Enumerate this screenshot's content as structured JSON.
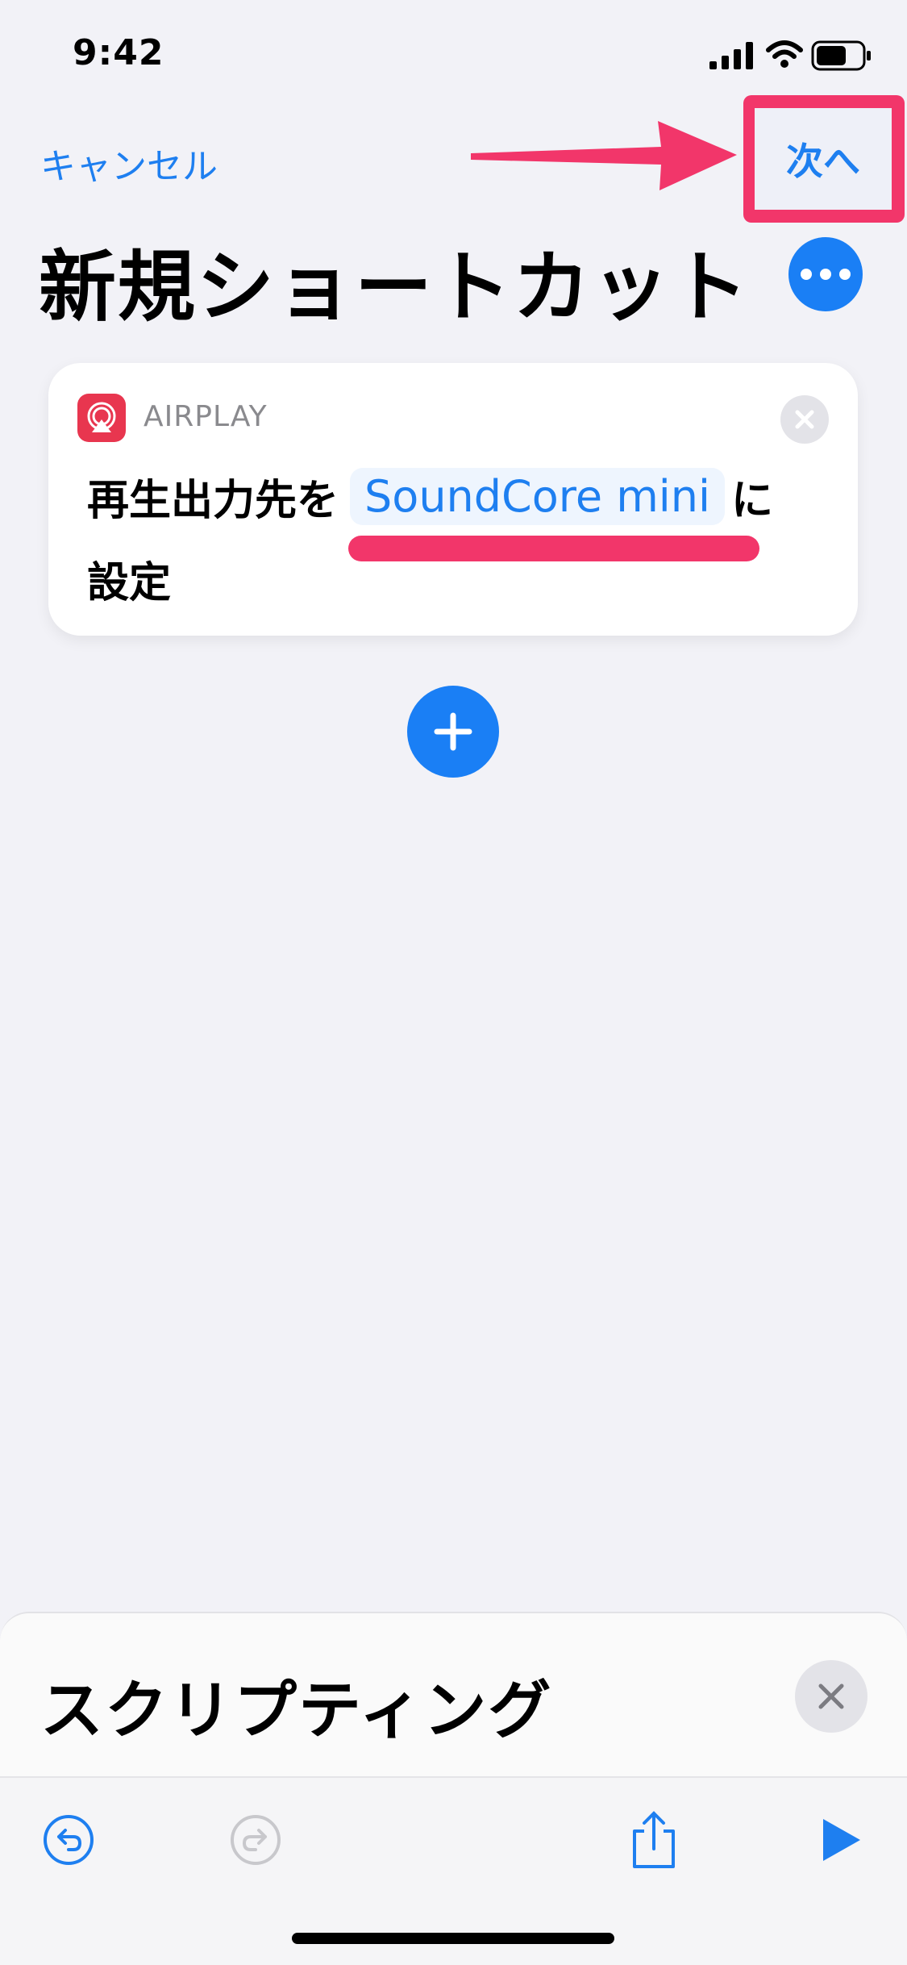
{
  "status_bar": {
    "time": "9:42"
  },
  "nav": {
    "cancel_label": "キャンセル",
    "next_label": "次へ"
  },
  "page": {
    "title": "新規ショートカット"
  },
  "action_card": {
    "app_name": "AIRPLAY",
    "text_before": "再生出力先を",
    "parameter": "SoundCore mini",
    "text_after": "に",
    "text_line2": "設定"
  },
  "bottom_sheet": {
    "title": "スクリプティング"
  },
  "colors": {
    "accent": "#1e7ff0",
    "highlight": "#f2366a",
    "airplay": "#e8364f",
    "background": "#f2f2f7"
  },
  "icons": [
    "signal-icon",
    "wifi-icon",
    "battery-icon",
    "more-icon",
    "airplay-icon",
    "close-icon",
    "plus-icon",
    "undo-icon",
    "redo-icon",
    "share-icon",
    "play-icon"
  ]
}
